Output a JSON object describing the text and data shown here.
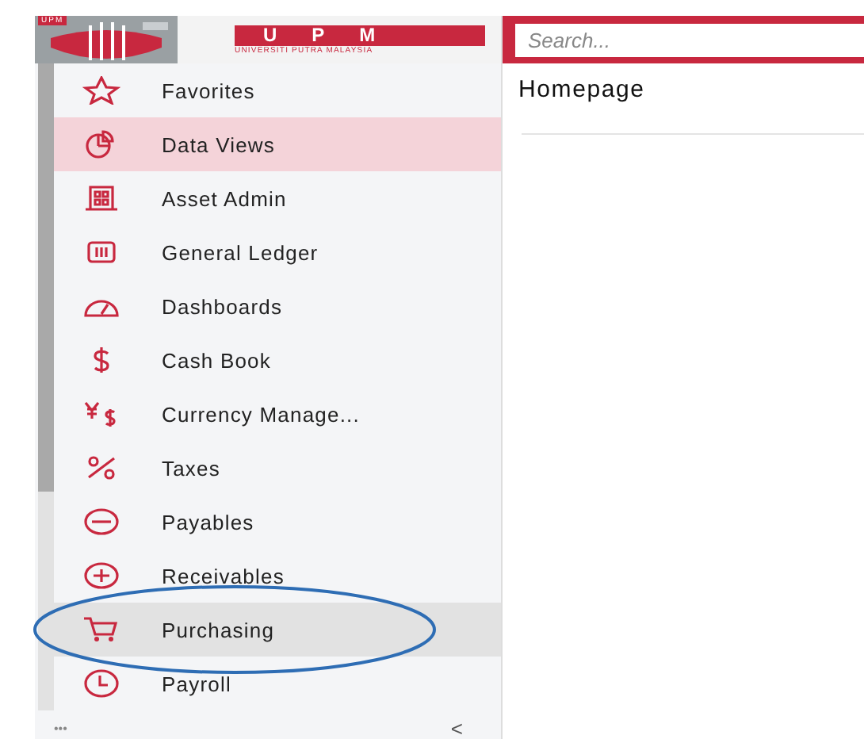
{
  "logo": {
    "small_mark": "UPM",
    "wordmark": "UPM",
    "subtitle": "UNIVERSITI PUTRA MALAYSIA"
  },
  "search": {
    "placeholder": "Search..."
  },
  "sidebar": {
    "items": [
      {
        "label": "Favorites",
        "selected": false,
        "hovered": false,
        "circled": false
      },
      {
        "label": "Data Views",
        "selected": true,
        "hovered": false,
        "circled": false
      },
      {
        "label": "Asset Admin",
        "selected": false,
        "hovered": false,
        "circled": false
      },
      {
        "label": "General Ledger",
        "selected": false,
        "hovered": false,
        "circled": false
      },
      {
        "label": "Dashboards",
        "selected": false,
        "hovered": false,
        "circled": false
      },
      {
        "label": "Cash Book",
        "selected": false,
        "hovered": false,
        "circled": false
      },
      {
        "label": "Currency Manage...",
        "selected": false,
        "hovered": false,
        "circled": false
      },
      {
        "label": "Taxes",
        "selected": false,
        "hovered": false,
        "circled": false
      },
      {
        "label": "Payables",
        "selected": false,
        "hovered": false,
        "circled": false
      },
      {
        "label": "Receivables",
        "selected": false,
        "hovered": false,
        "circled": false
      },
      {
        "label": "Purchasing",
        "selected": false,
        "hovered": true,
        "circled": true
      },
      {
        "label": "Payroll",
        "selected": false,
        "hovered": false,
        "circled": false
      }
    ],
    "footer": {
      "more": "•••",
      "collapse": "<"
    }
  },
  "main": {
    "title": "Homepage"
  }
}
